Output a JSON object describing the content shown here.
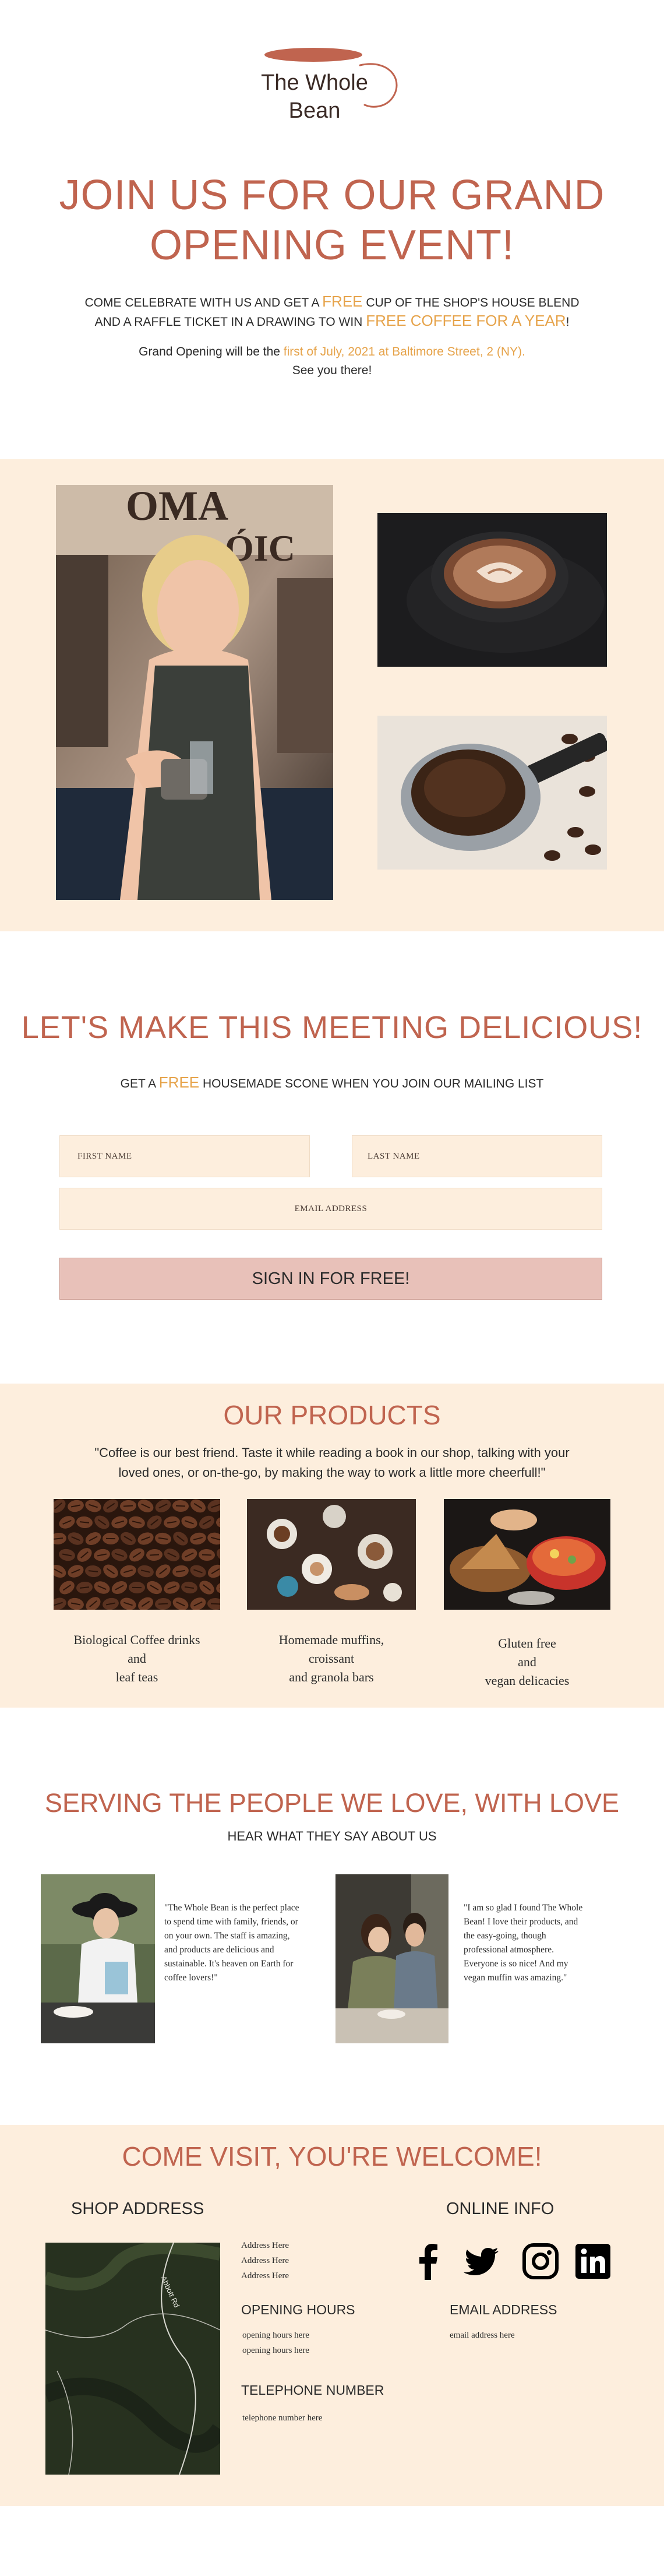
{
  "brand": {
    "name_line1": "The Whole",
    "name_line2": "Bean",
    "accent_color": "#c0644f",
    "highlight_color": "#e6a34a",
    "cream_color": "#fdeedd"
  },
  "hero": {
    "title_line1": "JOIN US FOR OUR GRAND",
    "title_line2": "OPENING EVENT!",
    "line1_a": "COME CELEBRATE WITH US AND GET A ",
    "line1_free": "FREE",
    "line1_b": " CUP OF THE SHOP'S HOUSE BLEND",
    "line2_a": "AND A RAFFLE TICKET IN A DRAWING TO WIN ",
    "line2_prize": "FREE COFFEE FOR A YEAR",
    "line2_b": "!",
    "line3_a": "Grand Opening will be the ",
    "line3_date": "first of July, 2021 at Baltimore Street, 2 (NY).",
    "line4": "See you there!"
  },
  "mailing": {
    "title": "LET'S MAKE THIS MEETING DELICIOUS!",
    "sub_a": "GET A ",
    "sub_free": "FREE",
    "sub_b": " HOUSEMADE SCONE WHEN YOU JOIN OUR MAILING LIST",
    "first_name_placeholder": "FIRST NAME",
    "last_name_placeholder": "LAST NAME",
    "email_placeholder": "EMAIL ADDRESS",
    "submit_label": "SIGN IN FOR FREE!"
  },
  "products": {
    "title": "OUR PRODUCTS",
    "quote_line1": "\"Coffee is our best friend. Taste it while reading a book in our shop, talking with your",
    "quote_line2": "loved ones, or on-the-go, by making the way to work a little more cheerfull!\"",
    "items": [
      {
        "line1": "Biological Coffee drinks",
        "line2": "and",
        "line3": "leaf teas"
      },
      {
        "line1": "Homemade muffins,",
        "line2": "croissant",
        "line3": "and granola bars"
      },
      {
        "line1": "Gluten free",
        "line2": "and",
        "line3": "vegan delicacies"
      }
    ]
  },
  "testimonials": {
    "title": "SERVING THE PEOPLE WE LOVE, WITH LOVE",
    "subtitle": "HEAR WHAT THEY SAY ABOUT US",
    "items": [
      {
        "text": "\"The Whole Bean is the perfect place to spend time with family, friends, or on your own. The staff is amazing, and products are delicious and sustainable. It's heaven on Earth for coffee lovers!\""
      },
      {
        "text": "\"I am so glad I found The Whole Bean! I love their products, and the easy-going, though professional atmosphere. Everyone is so nice! And my vegan muffin was amazing.\""
      }
    ]
  },
  "visit": {
    "title": "COME VISIT, YOU'RE WELCOME!",
    "shop_address_head": "SHOP ADDRESS",
    "online_info_head": "ONLINE INFO",
    "address_lines": [
      "Address Here",
      "Address Here",
      "Address Here"
    ],
    "hours_head": "OPENING HOURS",
    "hours_lines": [
      "opening hours here",
      "opening hours here"
    ],
    "phone_head": "TELEPHONE NUMBER",
    "phone_line": "telephone number here",
    "email_head": "EMAIL ADDRESS",
    "email_line": "email address here",
    "map_label": "Abbott Rd",
    "social_icons": [
      "facebook-icon",
      "twitter-icon",
      "instagram-icon",
      "linkedin-icon"
    ]
  }
}
